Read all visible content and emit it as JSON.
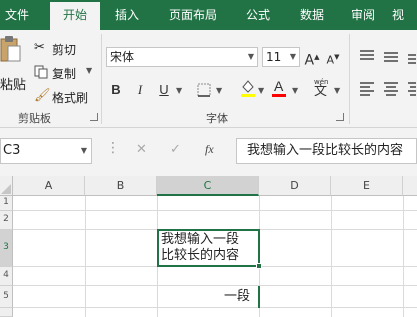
{
  "tabs": [
    {
      "label": "文件",
      "active": false
    },
    {
      "label": "开始",
      "active": true
    },
    {
      "label": "插入",
      "active": false
    },
    {
      "label": "页面布局",
      "active": false
    },
    {
      "label": "公式",
      "active": false
    },
    {
      "label": "数据",
      "active": false
    },
    {
      "label": "审阅",
      "active": false
    },
    {
      "label": "视",
      "active": false
    }
  ],
  "clipboard": {
    "paste_label": "贴",
    "paste_sub": "粘贴",
    "cut_label": "剪切",
    "copy_label": "复制",
    "format_painter_label": "格式刷",
    "group_label": "剪贴板"
  },
  "font": {
    "font_name": "宋体",
    "font_size": "11",
    "grow_label": "A",
    "shrink_label": "A",
    "bold_label": "B",
    "italic_label": "I",
    "underline_label": "U",
    "font_color_label": "A",
    "phonetic_label": "文",
    "phonetic_ruby": "wén",
    "group_label": "字体",
    "fill_color": "#ffff00",
    "font_color": "#ff0000"
  },
  "formula_bar": {
    "name_box": "C3",
    "cancel_icon": "✕",
    "enter_icon": "✓",
    "fx_label": "fx",
    "content": "我想输入一段比较长的内容"
  },
  "sheet": {
    "columns": [
      "A",
      "B",
      "C",
      "D",
      "E"
    ],
    "selected_column": "C",
    "row_labels": [
      "1",
      "2",
      "3",
      "4",
      "5"
    ],
    "selected_row": "3",
    "cell_c3_line1": "我想输入一段",
    "cell_c3_line2": "比较长的内容",
    "cell_c5_partial": "一段"
  },
  "colors": {
    "ribbon_tabbar": "#217346",
    "ribbon_bg": "#f3f3f3",
    "selection": "#217346"
  }
}
